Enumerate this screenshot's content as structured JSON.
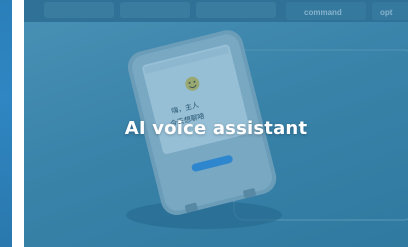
{
  "card": {
    "title": "AI voice assistant"
  },
  "image": {
    "keyboard_keys": [
      "command",
      "opt"
    ],
    "screen_lines": [
      "嗨，主人",
      "今天想聊啥"
    ]
  },
  "colors": {
    "overlay": "#1878af",
    "prev_slide": "#2f86c2",
    "device_button": "#3a8fe0",
    "title_text": "#ffffff"
  },
  "icons": {
    "device_face": "smiley-icon"
  }
}
